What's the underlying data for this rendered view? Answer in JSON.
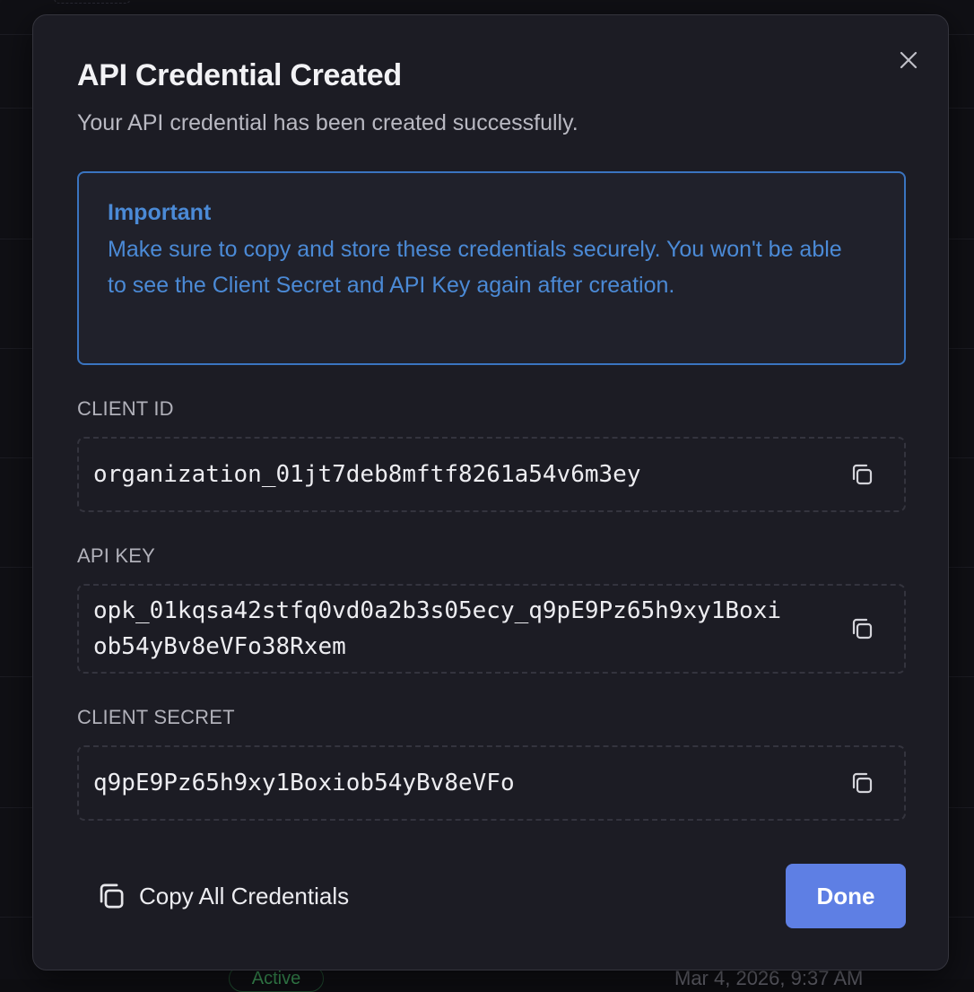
{
  "background": {
    "badge": "Active",
    "date": "Mar 4, 2026, 9:37 AM"
  },
  "dialog": {
    "title": "API Credential Created",
    "subtitle": "Your API credential has been created successfully.",
    "notice": {
      "title": "Important",
      "body": "Make sure to copy and store these credentials securely. You won't be able to see the Client Secret and API Key again after creation."
    },
    "fields": [
      {
        "label": "CLIENT ID",
        "value": "organization_01jt7deb8mftf8261a54v6m3ey"
      },
      {
        "label": "API KEY",
        "value": "opk_01kqsa42stfq0vd0a2b3s05ecy_q9pE9Pz65h9xy1Boxiob54yBv8eVFo38Rxem"
      },
      {
        "label": "CLIENT SECRET",
        "value": "q9pE9Pz65h9xy1Boxiob54yBv8eVFo"
      }
    ],
    "copy_all_label": "Copy All Credentials",
    "done_label": "Done"
  },
  "icons": {
    "close": "close-icon",
    "copy": "copy-icon"
  },
  "colors": {
    "accent": "#5e7fe4",
    "notice": "#4b8ad6",
    "surface": "#1c1c24"
  }
}
